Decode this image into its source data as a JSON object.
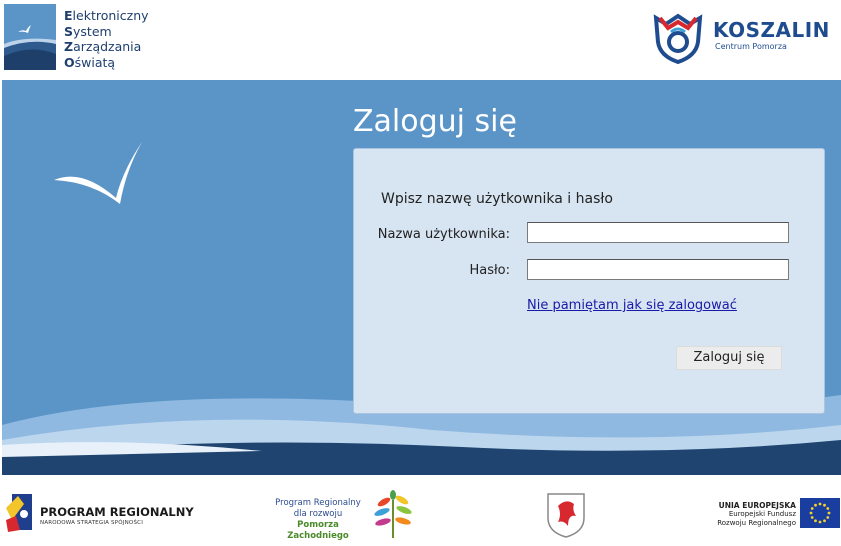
{
  "header": {
    "eso_lines": [
      {
        "initial": "E",
        "rest": "lektroniczny"
      },
      {
        "initial": "S",
        "rest": "ystem"
      },
      {
        "initial": "Z",
        "rest": "arządzania"
      },
      {
        "initial": "O",
        "rest": "światą"
      }
    ],
    "city_name": "KOSZALIN",
    "city_subtitle": "Centrum Pomorza"
  },
  "login": {
    "title": "Zaloguj się",
    "heading": "Wpisz nazwę użytkownika i hasło",
    "username_label": "Nazwa użytkownika:",
    "username_value": "",
    "password_label": "Hasło:",
    "password_value": "",
    "forgot_link": "Nie pamiętam jak się zalogować",
    "submit_label": "Zaloguj się"
  },
  "footer": {
    "program_regionalny_title": "PROGRAM REGIONALNY",
    "program_regionalny_sub": "NARODOWA STRATEGIA SPÓJNOŚCI",
    "prpz_line1": "Program Regionalny",
    "prpz_line2": "dla rozwoju",
    "prpz_line3": "Pomorza Zachodniego",
    "eu_line1": "UNIA EUROPEJSKA",
    "eu_line2": "Europejski Fundusz",
    "eu_line3": "Rozwoju Regionalnego"
  },
  "colors": {
    "main_background": "#5b95c8",
    "panel_background": "#d7e4f1",
    "link": "#1a1aa8",
    "brand_blue": "#1f4c8f",
    "brand_red": "#d8282f"
  }
}
